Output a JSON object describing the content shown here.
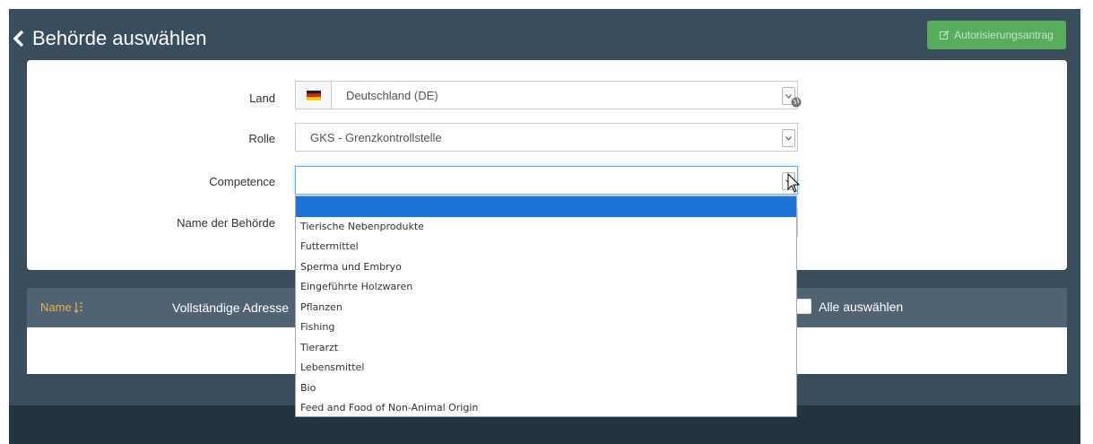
{
  "header": {
    "title": "Behörde auswählen",
    "back_icon": "chevron-left-icon",
    "auth_button_label": "Autorisierungsantrag",
    "auth_button_icon": "edit-icon"
  },
  "form": {
    "land": {
      "label": "Land",
      "value": "Deutschland (DE)",
      "flag_icon": "germany-flag-icon",
      "globe_icon": "globe-icon"
    },
    "rolle": {
      "label": "Rolle",
      "value": "GKS - Grenzkontrollstelle"
    },
    "competence": {
      "label": "Competence",
      "value": "",
      "options": [
        "",
        "Tierische Nebenprodukte",
        "Futtermittel",
        "Sperma und Embryo",
        "Eingeführte Holzwaren",
        "Pflanzen",
        "Fishing",
        "Tierarzt",
        "Lebensmittel",
        "Bio",
        "Feed and Food of Non-Animal Origin"
      ]
    },
    "behoerde": {
      "label": "Name der Behörde"
    }
  },
  "table": {
    "col_name": "Name",
    "col_address": "Vollständige Adresse",
    "select_all_label": "Alle auswählen"
  },
  "colors": {
    "page_bg": "#3a4d5d",
    "table_header_bg": "#4f6373",
    "accent_green": "#5cb85c",
    "sort_accent": "#f0ad4e",
    "highlight_blue": "#1e73d9"
  }
}
